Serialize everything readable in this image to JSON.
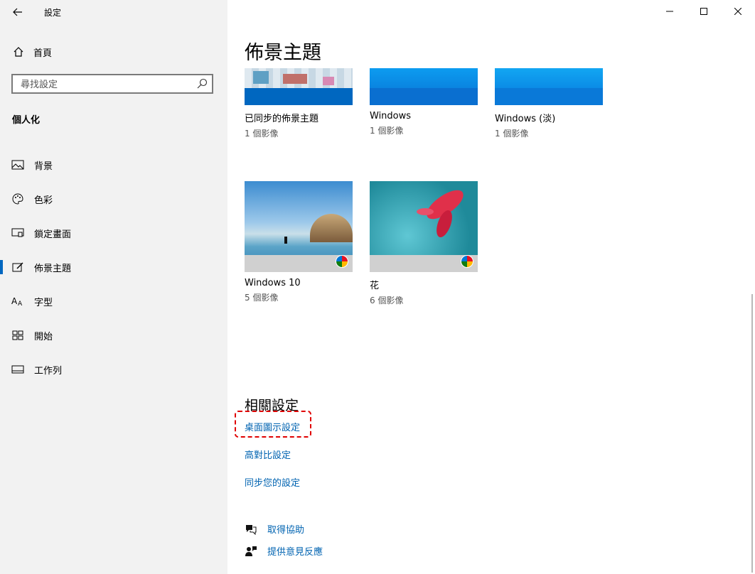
{
  "app": {
    "title": "設定"
  },
  "sidebar": {
    "home_label": "首頁",
    "search_placeholder": "尋找設定",
    "section_label": "個人化",
    "items": [
      {
        "label": "背景",
        "icon": "picture-icon"
      },
      {
        "label": "色彩",
        "icon": "palette-icon"
      },
      {
        "label": "鎖定畫面",
        "icon": "lock-screen-icon"
      },
      {
        "label": "佈景主題",
        "icon": "theme-brush-icon",
        "active": true
      },
      {
        "label": "字型",
        "icon": "font-icon"
      },
      {
        "label": "開始",
        "icon": "start-icon"
      },
      {
        "label": "工作列",
        "icon": "taskbar-icon"
      }
    ]
  },
  "main": {
    "title": "佈景主題",
    "themes": [
      {
        "name": "已同步的佈景主題",
        "count": "1 個影像"
      },
      {
        "name": "Windows",
        "count": "1 個影像"
      },
      {
        "name": "Windows (淡)",
        "count": "1 個影像"
      },
      {
        "name": "Windows 10",
        "count": "5 個影像"
      },
      {
        "name": "花",
        "count": "6 個影像"
      }
    ],
    "related": {
      "title": "相關設定",
      "links": [
        "桌面圖示設定",
        "高對比設定",
        "同步您的設定"
      ]
    },
    "help": {
      "get_help": "取得協助",
      "feedback": "提供意見反應"
    }
  },
  "colors": {
    "accent": "#0063b1",
    "highlight": "#e00000",
    "sidebar_bg": "#f2f2f2"
  }
}
